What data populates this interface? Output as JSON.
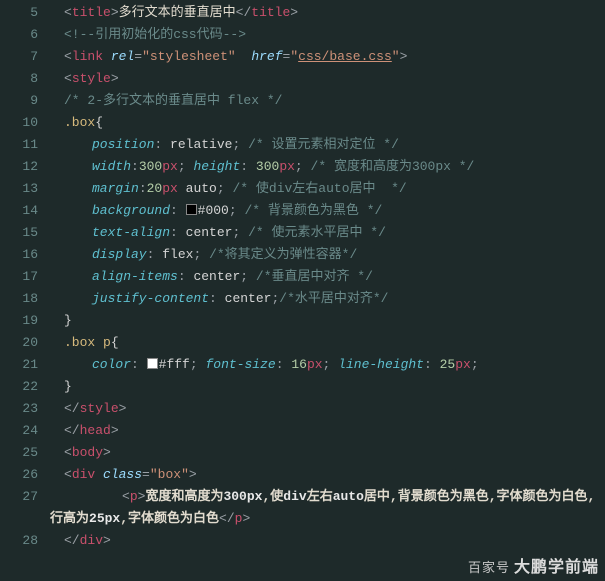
{
  "gutter": {
    "start": 5,
    "end": 28
  },
  "lines": {
    "l5": {
      "tag_open": "title",
      "text": "多行文本的垂直居中",
      "tag_close": "title"
    },
    "l6": {
      "comment": "<!--引用初始化的css代码-->"
    },
    "l7": {
      "tag": "link",
      "attr1": "rel",
      "val1": "stylesheet",
      "attr2": "href",
      "val2": "css/base.css"
    },
    "l8": {
      "tag": "style"
    },
    "l9": {
      "comment": "/* 2-多行文本的垂直居中 flex */"
    },
    "l10": {
      "selector": ".box"
    },
    "l11": {
      "prop": "position",
      "val": "relative",
      "comment": "/* 设置元素相对定位 */"
    },
    "l12": {
      "p1": "width",
      "v1n": "300",
      "v1u": "px",
      "p2": "height",
      "v2n": "300",
      "v2u": "px",
      "comment": "/* 宽度和高度为300px */"
    },
    "l13": {
      "prop": "margin",
      "v1n": "20",
      "v1u": "px",
      "v2": "auto",
      "comment": "/* 使div左右auto居中  */"
    },
    "l14": {
      "prop": "background",
      "hex": "#000",
      "comment": "/* 背景颜色为黑色 */"
    },
    "l15": {
      "prop": "text-align",
      "val": "center",
      "comment": "/* 使元素水平居中 */"
    },
    "l16": {
      "prop": "display",
      "val": "flex",
      "comment": "/*将其定义为弹性容器*/"
    },
    "l17": {
      "prop": "align-items",
      "val": "center",
      "comment": "/*垂直居中对齐 */"
    },
    "l18": {
      "prop": "justify-content",
      "val": "center",
      "comment": "/*水平居中对齐*/"
    },
    "l20": {
      "selector": ".box p"
    },
    "l21": {
      "p1": "color",
      "hex": "#fff",
      "p2": "font-size",
      "v2n": "16",
      "v2u": "px",
      "p3": "line-height",
      "v3n": "25",
      "v3u": "px"
    },
    "l23": {
      "tag": "style"
    },
    "l24": {
      "tag": "head"
    },
    "l25": {
      "tag": "body"
    },
    "l26": {
      "tag": "div",
      "attr": "class",
      "val": "box"
    },
    "l27": {
      "tag": "p",
      "text": "宽度和高度为300px,使div左右auto居中,背景颜色为黑色,字体颜色为白色, 行高为25px,字体颜色为白色"
    },
    "l28": {
      "tag": "div"
    }
  },
  "watermark": {
    "prefix": "百家号",
    "name": "大鹏学前端"
  }
}
